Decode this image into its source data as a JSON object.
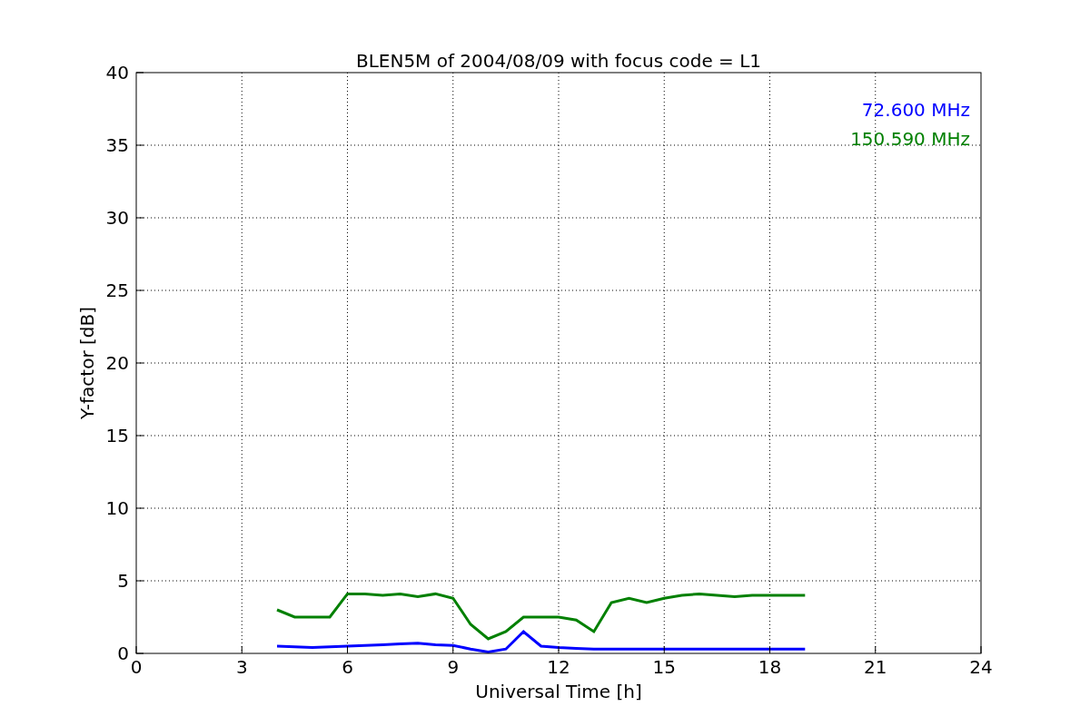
{
  "chart_data": {
    "type": "line",
    "title": "BLEN5M of 2004/08/09 with focus code = L1",
    "xlabel": "Universal Time [h]",
    "ylabel": "Y-factor [dB]",
    "x": [
      4,
      4.5,
      5,
      5.5,
      6,
      6.5,
      7,
      7.5,
      8,
      8.5,
      9,
      9.5,
      10,
      10.5,
      11,
      11.5,
      12,
      12.5,
      13,
      13.5,
      14,
      14.5,
      15,
      15.5,
      16,
      16.5,
      17,
      17.5,
      18,
      18.5,
      19
    ],
    "series": [
      {
        "name": "72.600 MHz",
        "color": "#0000ff",
        "values": [
          0.5,
          0.45,
          0.4,
          0.45,
          0.5,
          0.55,
          0.6,
          0.65,
          0.7,
          0.6,
          0.55,
          0.3,
          0.1,
          0.3,
          1.5,
          0.5,
          0.4,
          0.35,
          0.3,
          0.3,
          0.3,
          0.3,
          0.3,
          0.3,
          0.3,
          0.3,
          0.3,
          0.3,
          0.3,
          0.3,
          0.3
        ]
      },
      {
        "name": "150.590 MHz",
        "color": "#008000",
        "values": [
          3,
          2.5,
          2.5,
          2.5,
          4.1,
          4.1,
          4,
          4.1,
          3.9,
          4.1,
          3.8,
          2,
          1,
          1.5,
          2.5,
          2.5,
          2.5,
          2.3,
          1.5,
          3.5,
          3.8,
          3.5,
          3.8,
          4,
          4.1,
          4,
          3.9,
          4,
          4,
          4,
          4
        ]
      }
    ],
    "grid": true,
    "xlim": [
      0,
      24
    ],
    "ylim": [
      0,
      40
    ],
    "xticks": [
      0,
      3,
      6,
      9,
      12,
      15,
      18,
      21,
      24
    ],
    "yticks": [
      0,
      5,
      10,
      15,
      20,
      25,
      30,
      35,
      40
    ]
  }
}
